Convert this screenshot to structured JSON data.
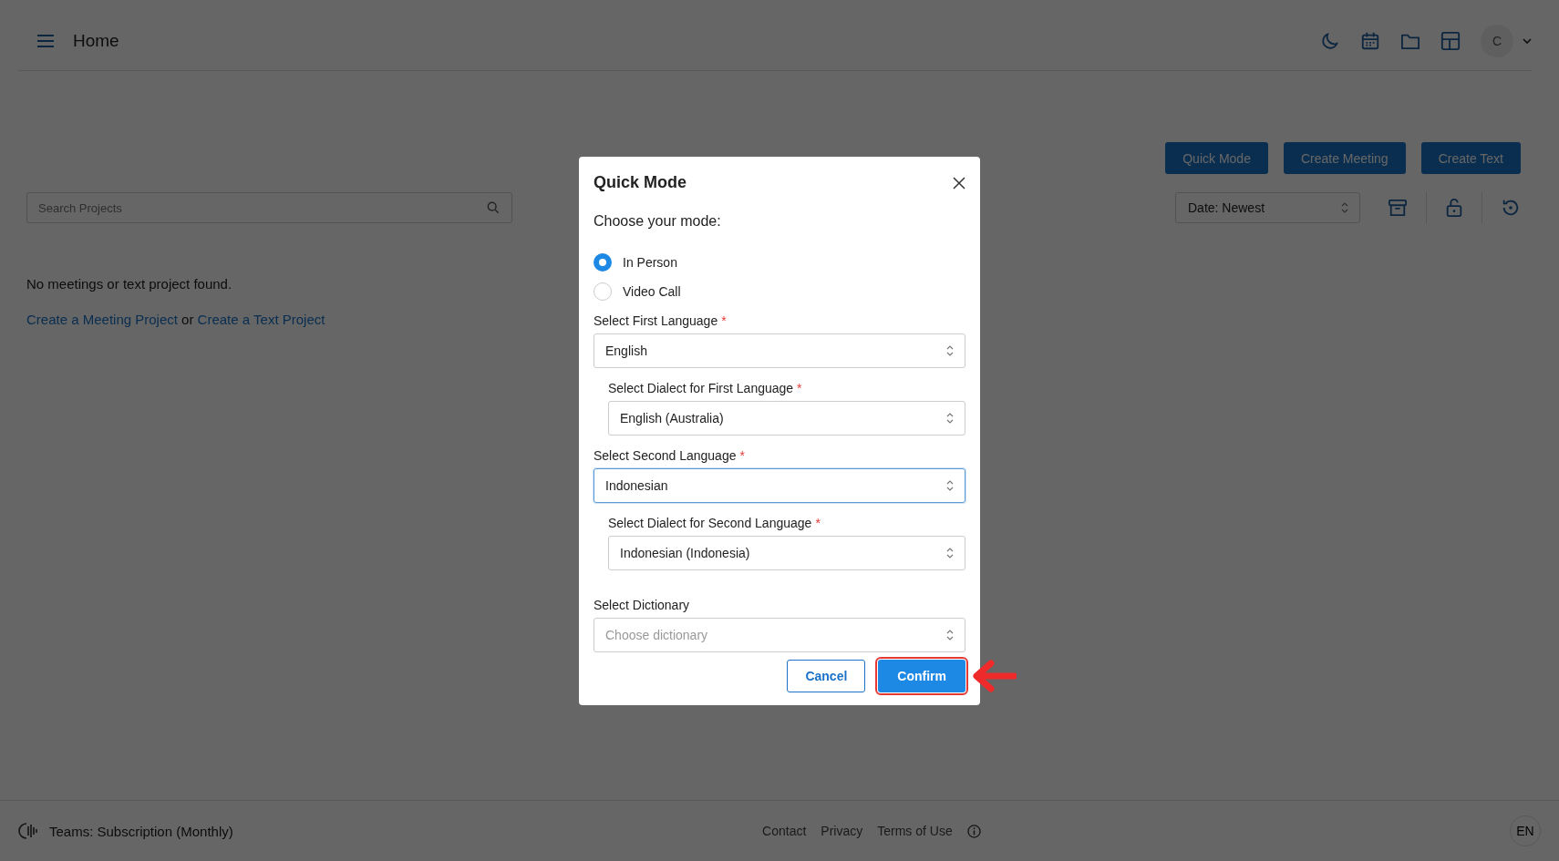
{
  "header": {
    "title": "Home",
    "avatar_initial": "C"
  },
  "actions": {
    "buttons": [
      "Quick Mode",
      "Create Meeting",
      "Create Text"
    ]
  },
  "search": {
    "placeholder": "Search Projects"
  },
  "sort": {
    "value": "Date: Newest"
  },
  "empty": {
    "message": "No meetings or text project found.",
    "link_1": "Create a Meeting Project",
    "joiner": "or",
    "link_2": "Create a Text Project"
  },
  "dialog": {
    "title": "Quick Mode",
    "prompt": "Choose your mode:",
    "modes": [
      {
        "label": "In Person",
        "selected": true
      },
      {
        "label": "Video Call",
        "selected": false
      }
    ],
    "fields": [
      {
        "label": "Select First Language",
        "required_mark": "*",
        "value": "English",
        "focused": false,
        "children": [
          {
            "label": "Select Dialect for First Language",
            "required_mark": "*",
            "value": "English (Australia)",
            "focused": false
          }
        ]
      },
      {
        "label": "Select Second Language",
        "required_mark": "*",
        "value": "Indonesian",
        "focused": true,
        "children": [
          {
            "label": "Select Dialect for Second Language",
            "required_mark": "*",
            "value": "Indonesian (Indonesia)",
            "focused": false
          }
        ]
      },
      {
        "label": "Select Dictionary",
        "placeholder": "Choose dictionary",
        "focused": false
      }
    ],
    "buttons": [
      {
        "label": "Cancel",
        "kind": "secondary",
        "highlighted": false
      },
      {
        "label": "Confirm",
        "kind": "primary",
        "highlighted": true
      }
    ]
  },
  "footer": {
    "plan": "Teams: Subscription (Monthly)",
    "links": [
      "Contact",
      "Privacy",
      "Terms of Use"
    ],
    "language": "EN"
  }
}
